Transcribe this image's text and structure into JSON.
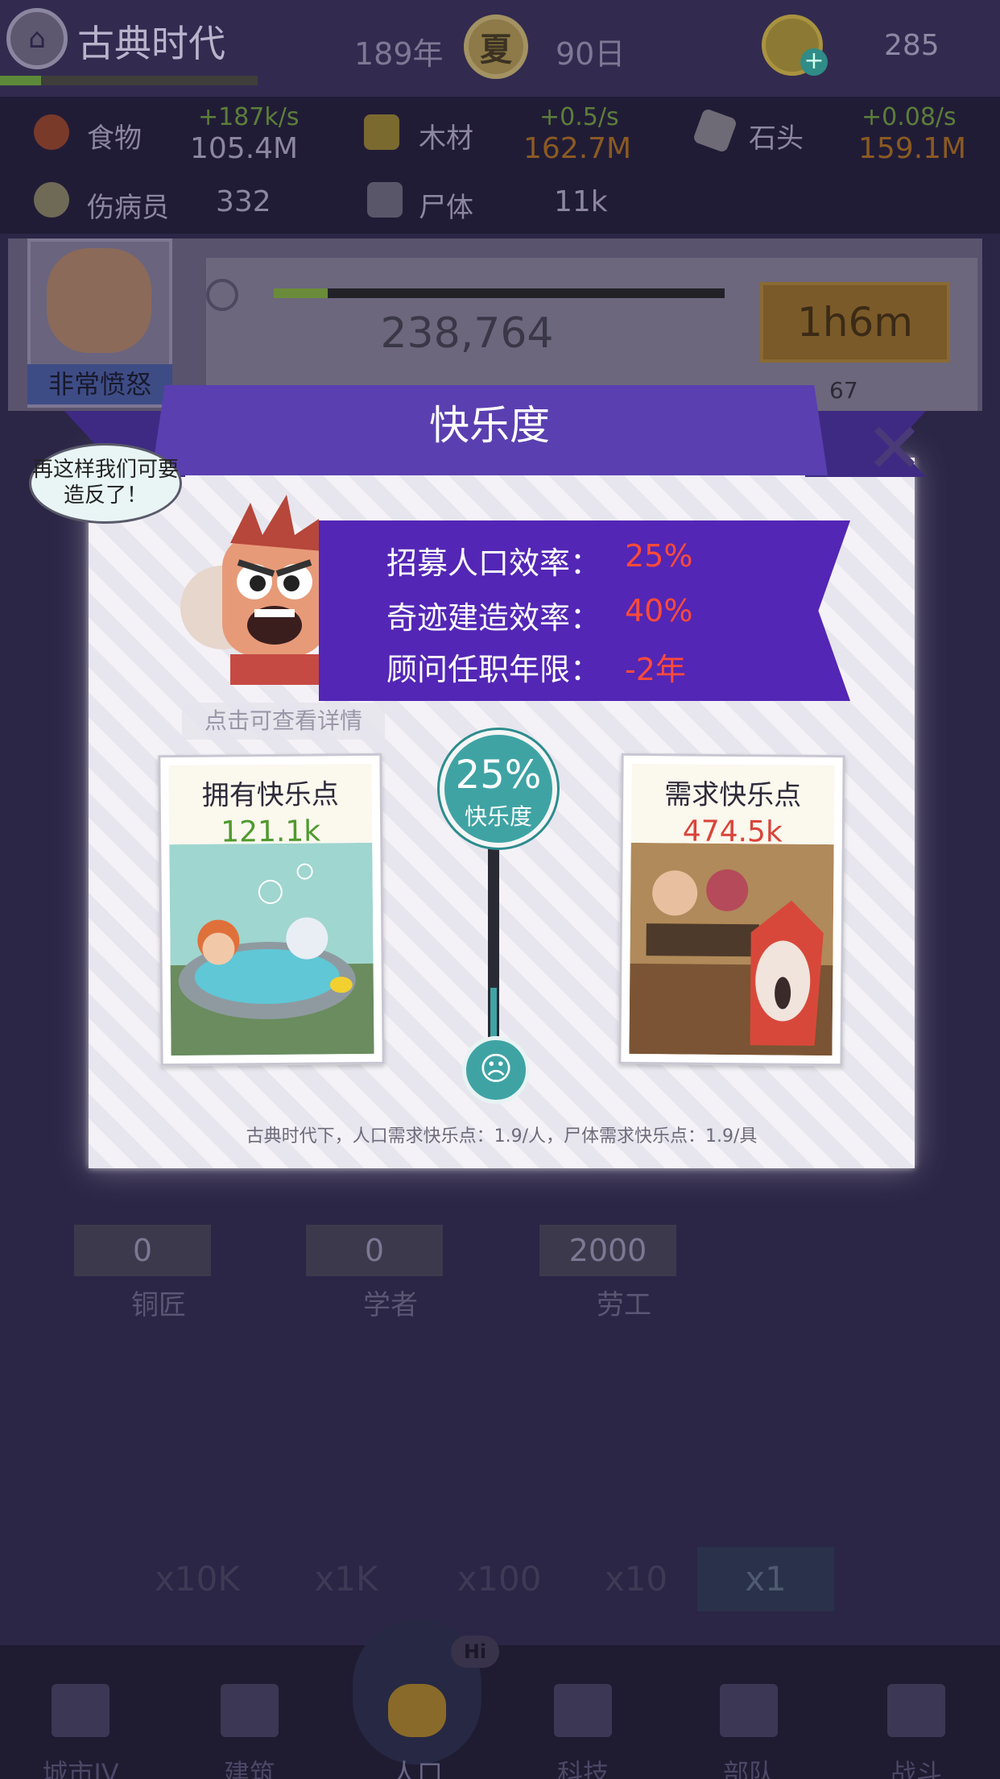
{
  "header": {
    "era_title": "古典时代",
    "year": "189年",
    "season": "夏",
    "day": "90日",
    "gold": "285"
  },
  "resources": {
    "food": {
      "label": "食物",
      "rate": "+187k/s",
      "value": "105.4M"
    },
    "wood": {
      "label": "木材",
      "rate": "+0.5/s",
      "value": "162.7M"
    },
    "stone": {
      "label": "石头",
      "rate": "+0.08/s",
      "value": "159.1M"
    },
    "wounded": {
      "label": "伤病员",
      "value": "332"
    },
    "corpse": {
      "label": "尸体",
      "value": "11k"
    }
  },
  "population_panel": {
    "leader_mood": "非常愤怒",
    "population": "238,764",
    "timer": "1h6m",
    "gems": "67"
  },
  "jobs": [
    {
      "name": "铜匠",
      "count": "0"
    },
    {
      "name": "学者",
      "count": "0"
    },
    {
      "name": "劳工",
      "count": "2000"
    }
  ],
  "multipliers": [
    "x10K",
    "x1K",
    "x100",
    "x10",
    "x1"
  ],
  "selected_multiplier": "x1",
  "nav": [
    {
      "label": "城市IV"
    },
    {
      "label": "建筑"
    },
    {
      "label": "人口"
    },
    {
      "label": "科技"
    },
    {
      "label": "部队"
    },
    {
      "label": "战斗"
    }
  ],
  "nav_badge": "Hi",
  "modal": {
    "title": "快乐度",
    "speech": "再这样我们可要造反了！",
    "hint": "点击可查看详情",
    "effects": [
      {
        "label": "招募人口效率：",
        "value": "25%"
      },
      {
        "label": "奇迹建造效率：",
        "value": "40%"
      },
      {
        "label": "顾问任职年限：",
        "value": "-2年"
      }
    ],
    "owned": {
      "title": "拥有快乐点",
      "value": "121.1k"
    },
    "required": {
      "title": "需求快乐点",
      "value": "474.5k"
    },
    "happiness_pct": "25%",
    "happiness_label": "快乐度",
    "happiness_level": 0.25,
    "footnote": "古典时代下，人口需求快乐点：1.9/人，尸体需求快乐点：1.9/具"
  },
  "colors": {
    "ribbon": "#5326b5",
    "effect_value": "#ff4a3a",
    "owned_value": "#4f9a2e",
    "required_value": "#d9443a",
    "gauge": "#3fa3a4"
  }
}
